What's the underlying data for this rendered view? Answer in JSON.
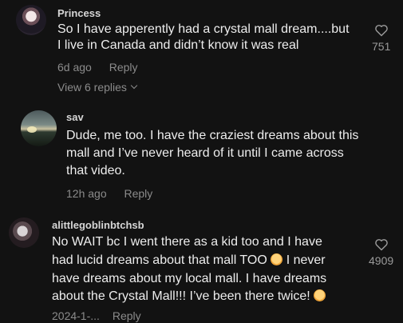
{
  "comments": [
    {
      "username": "Princess",
      "line1": "So I have apperently had a crystal mall dream....but",
      "line2": "I live in Canada and didn’t know it was real",
      "time": "6d ago",
      "reply_label": "Reply",
      "view_replies": "View 6 replies",
      "likes": "751",
      "avatar_icon": "profile-avatar"
    },
    {
      "username": "sav",
      "line1": "Dude, me too. I have the craziest dreams about this",
      "line2": "mall and I’ve never heard of it until I came across",
      "line3": "that video.",
      "time": "12h ago",
      "reply_label": "Reply",
      "avatar_icon": "profile-avatar"
    },
    {
      "username": "alittlegoblinbtchsb",
      "line1": "No WAIT bc I went there as a kid too and I have",
      "line2a": "had lucid dreams about that mall TOO",
      "line2b": "I never",
      "line3": "have dreams about my local mall. I have dreams",
      "line4": "about the Crystal Mall!!! I’ve been there twice!",
      "time": "2024-1-...",
      "reply_label": "Reply",
      "likes": "4909",
      "emoji_icon": "flushed-face-emoji",
      "avatar_icon": "profile-avatar"
    }
  ],
  "colors": {
    "background": "#121212",
    "text": "#ededed",
    "muted": "#8b8b8b"
  }
}
